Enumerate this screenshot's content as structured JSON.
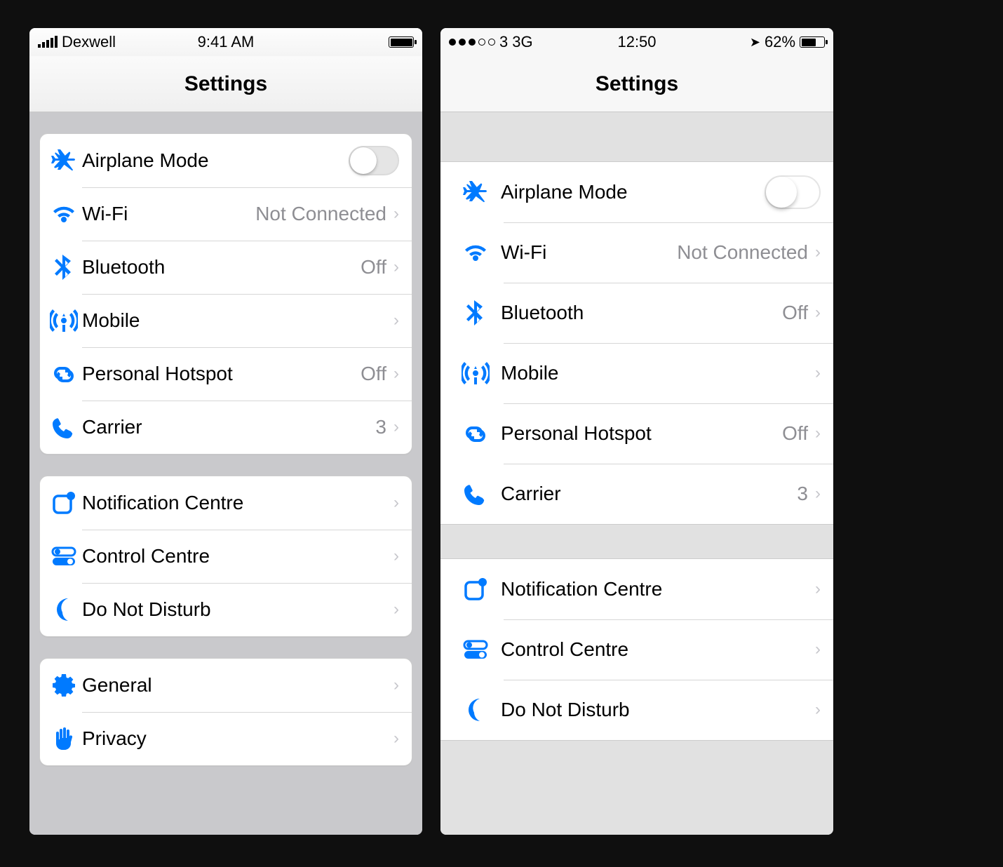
{
  "left": {
    "statusbar": {
      "carrier": "Dexwell",
      "time": "9:41 AM"
    },
    "title": "Settings",
    "groups": [
      {
        "rows": [
          {
            "icon": "airplane",
            "label": "Airplane Mode",
            "toggle": true
          },
          {
            "icon": "wifi",
            "label": "Wi-Fi",
            "value": "Not Connected",
            "chevron": true
          },
          {
            "icon": "bluetooth",
            "label": "Bluetooth",
            "value": "Off",
            "chevron": true
          },
          {
            "icon": "mobile",
            "label": "Mobile",
            "chevron": true
          },
          {
            "icon": "hotspot",
            "label": "Personal Hotspot",
            "value": "Off",
            "chevron": true
          },
          {
            "icon": "phone",
            "label": "Carrier",
            "value": "3",
            "chevron": true
          }
        ]
      },
      {
        "rows": [
          {
            "icon": "notification",
            "label": "Notification Centre",
            "chevron": true
          },
          {
            "icon": "control",
            "label": "Control Centre",
            "chevron": true
          },
          {
            "icon": "moon",
            "label": "Do Not Disturb",
            "chevron": true
          }
        ]
      },
      {
        "rows": [
          {
            "icon": "gear",
            "label": "General",
            "chevron": true
          },
          {
            "icon": "hand",
            "label": "Privacy",
            "chevron": true
          }
        ]
      }
    ]
  },
  "right": {
    "statusbar": {
      "carrier": "3",
      "network": "3G",
      "time": "12:50",
      "battery_pct": "62%"
    },
    "title": "Settings",
    "groups": [
      {
        "rows": [
          {
            "icon": "airplane",
            "label": "Airplane Mode",
            "toggle": true
          },
          {
            "icon": "wifi",
            "label": "Wi-Fi",
            "value": "Not Connected",
            "chevron": true
          },
          {
            "icon": "bluetooth",
            "label": "Bluetooth",
            "value": "Off",
            "chevron": true
          },
          {
            "icon": "mobile",
            "label": "Mobile",
            "chevron": true
          },
          {
            "icon": "hotspot",
            "label": "Personal Hotspot",
            "value": "Off",
            "chevron": true
          },
          {
            "icon": "phone",
            "label": "Carrier",
            "value": "3",
            "chevron": true
          }
        ]
      },
      {
        "rows": [
          {
            "icon": "notification",
            "label": "Notification Centre",
            "chevron": true
          },
          {
            "icon": "control",
            "label": "Control Centre",
            "chevron": true
          },
          {
            "icon": "moon",
            "label": "Do Not Disturb",
            "chevron": true
          }
        ]
      }
    ]
  },
  "icons": {
    "airplane": "airplane-icon",
    "wifi": "wifi-icon",
    "bluetooth": "bluetooth-icon",
    "mobile": "cellular-tower-icon",
    "hotspot": "hotspot-chain-icon",
    "phone": "phone-handset-icon",
    "notification": "notification-badge-icon",
    "control": "toggles-icon",
    "moon": "crescent-moon-icon",
    "gear": "gear-icon",
    "hand": "hand-icon"
  }
}
